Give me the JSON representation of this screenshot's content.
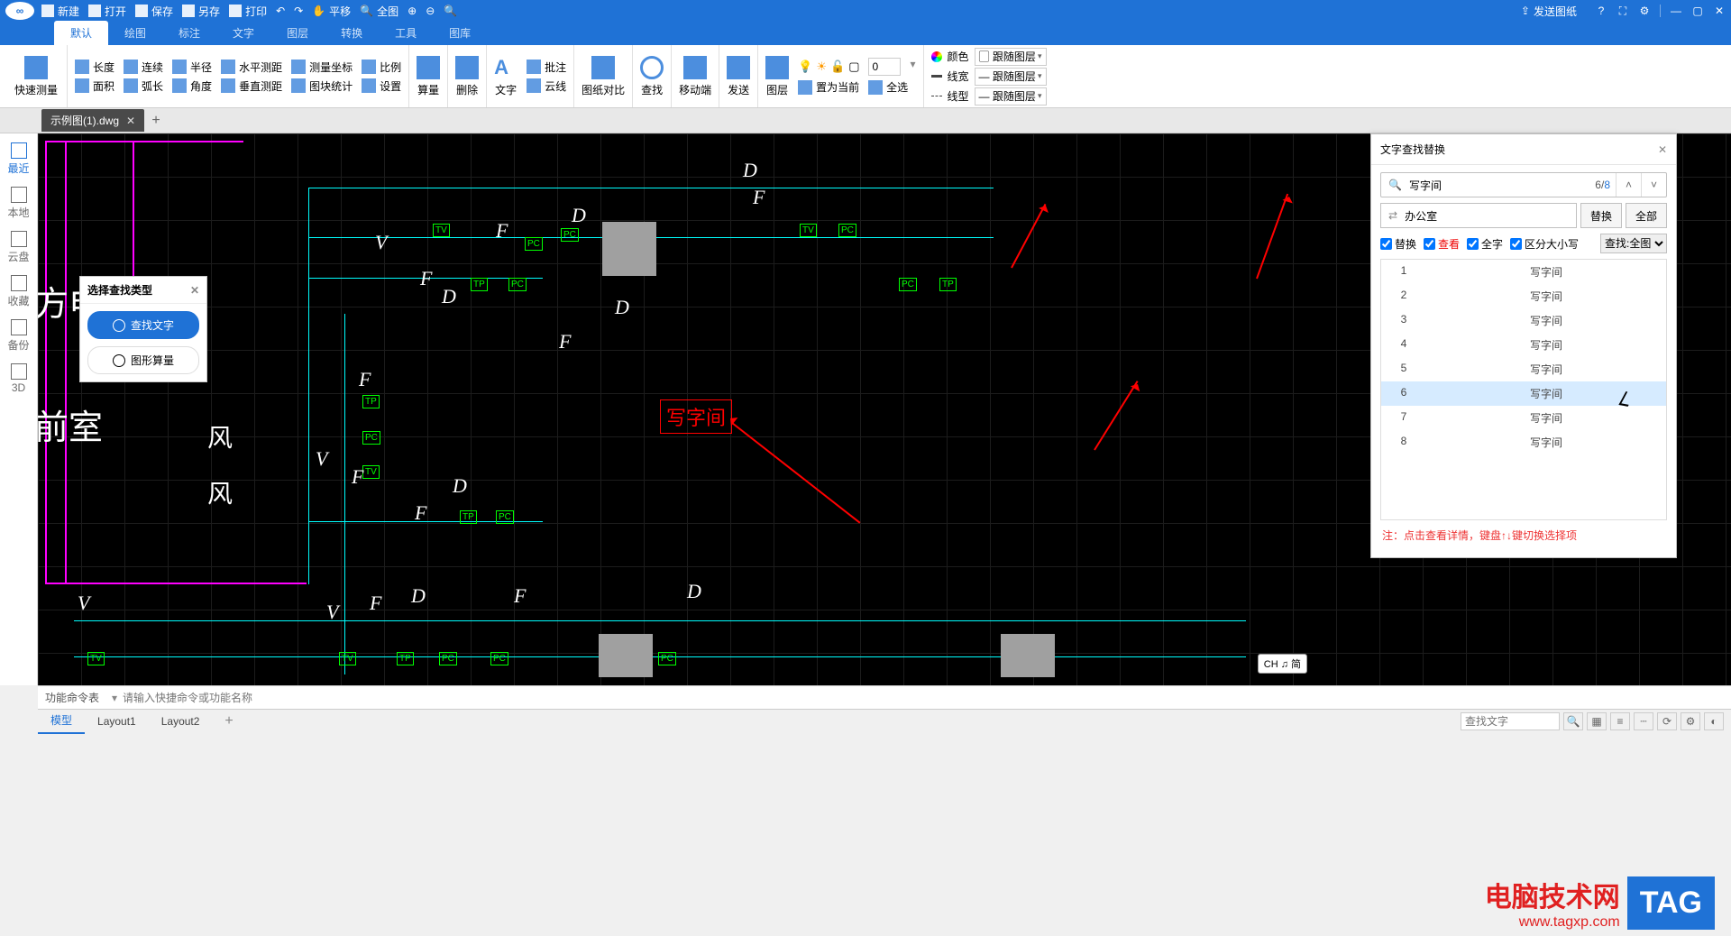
{
  "titlebar": {
    "items": [
      "新建",
      "打开",
      "保存",
      "另存",
      "打印"
    ],
    "send": "发送图纸"
  },
  "menus": [
    "默认",
    "绘图",
    "标注",
    "文字",
    "图层",
    "转换",
    "工具",
    "图库"
  ],
  "ribbon": {
    "quick_measure": "快速测量",
    "measure": {
      "r1": [
        "长度",
        "连续",
        "半径",
        "水平测距",
        "测量坐标",
        "比例"
      ],
      "r2": [
        "面积",
        "弧长",
        "角度",
        "垂直测距",
        "图块统计",
        "设置"
      ]
    },
    "edit": {
      "calc": "算量",
      "del": "删除"
    },
    "text": {
      "text": "文字",
      "cloud": "云线",
      "approve": "批注"
    },
    "view": {
      "compare": "图纸对比",
      "find": "查找"
    },
    "move": {
      "move": "移动端",
      "send": "发送"
    },
    "layer": {
      "layer": "图层",
      "current": "置为当前",
      "all": "全选",
      "num": "0"
    },
    "props": {
      "color": "颜色",
      "lw": "线宽",
      "lt": "线型",
      "follow": "跟随图层"
    }
  },
  "file_tab": "示例图(1).dwg",
  "leftrail": [
    "最近",
    "本地",
    "云盘",
    "收藏",
    "备份",
    "3D"
  ],
  "find_panel": {
    "title": "选择查找类型",
    "btn1": "查找文字",
    "btn2": "图形算量"
  },
  "canvas": {
    "t_elevator": "方电梯",
    "t_front": "前室",
    "t_wind": "风",
    "highlight": "写字间"
  },
  "fr": {
    "title": "文字查找替换",
    "search_value": "写字间",
    "count_cur": "6",
    "count_total": "8",
    "replace_value": "办公室",
    "btn_replace": "替换",
    "btn_all": "全部",
    "opt_replace": "替换",
    "opt_view": "查看",
    "opt_whole": "全字",
    "opt_case": "区分大小写",
    "scope": "查找:全图",
    "rows": [
      {
        "n": "1",
        "t": "写字间"
      },
      {
        "n": "2",
        "t": "写字间"
      },
      {
        "n": "3",
        "t": "写字间"
      },
      {
        "n": "4",
        "t": "写字间"
      },
      {
        "n": "5",
        "t": "写字间"
      },
      {
        "n": "6",
        "t": "写字间"
      },
      {
        "n": "7",
        "t": "写字间"
      },
      {
        "n": "8",
        "t": "写字间"
      }
    ],
    "note": "注：点击查看详情，键盘↑↓键切换选择项"
  },
  "cmd": {
    "label": "功能命令表",
    "placeholder": "请输入快捷命令或功能名称",
    "ime": "CH ♫ 简"
  },
  "btabs": [
    "模型",
    "Layout1",
    "Layout2"
  ],
  "bottom_search_ph": "查找文字",
  "wm": {
    "cn": "电脑技术网",
    "url": "www.tagxp.com",
    "tag": "TAG"
  }
}
